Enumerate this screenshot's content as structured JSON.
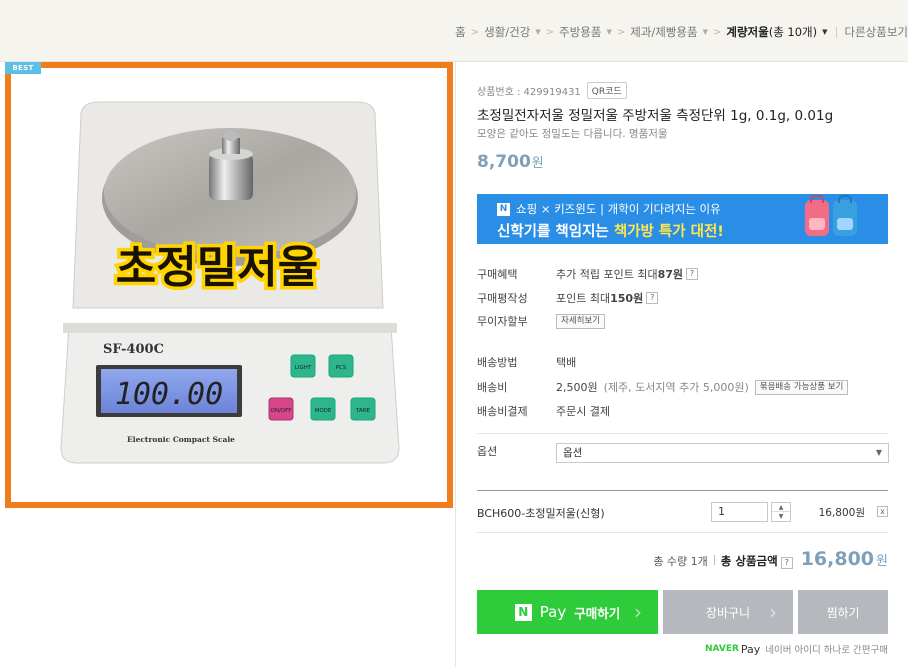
{
  "breadcrumb": {
    "home": "홈",
    "items": [
      "생활/건강",
      "주방용품",
      "제과/제빵용품"
    ],
    "current": "계량저울",
    "count": "(총 10개)",
    "other": "다른상품보기"
  },
  "image": {
    "badge": "BEST",
    "overlay_text": "초정밀저울",
    "device_model": "SF-400C",
    "display_value": "100.00",
    "device_caption": "Electronic Compact Scale",
    "keys": [
      "LIGHT",
      "PCS",
      "ON/OFF",
      "MODE",
      "TARE"
    ]
  },
  "product": {
    "code_label": "상품번호 : 429919431",
    "qr_label": "QR코드",
    "title": "초정밀전자저울 정밀저울 주방저울 측정단위 1g, 0.1g, 0.01g",
    "subtitle": "모양은 같아도 정밀도는 다릅니다. 명품저울",
    "price": "8,700",
    "currency": "원"
  },
  "banner": {
    "badge": "N",
    "line1": "쇼핑 × 키즈윈도 | 개학이 기다려지는 이유",
    "line2_a": "신학기를 책임지는 ",
    "line2_b": "책가방 특가 대전!"
  },
  "info": {
    "benefit_label": "구매혜택",
    "benefit_prefix": "추가 적립 포인트 최대 ",
    "benefit_value": "87원",
    "review_label": "구매평작성",
    "review_prefix": "포인트 최대 ",
    "review_value": "150원",
    "installment_label": "무이자할부",
    "installment_button": "자세히보기",
    "ship_method_label": "배송방법",
    "ship_method_value": "택배",
    "ship_fee_label": "배송비",
    "ship_fee_value": "2,500원",
    "ship_fee_note": "(제주, 도서지역 추가 5,000원)",
    "ship_fee_button": "묶음배송 가능상품 보기",
    "ship_pay_label": "배송비결제",
    "ship_pay_value": "주문시 결제"
  },
  "option": {
    "label": "옵션",
    "placeholder": "옵션"
  },
  "selected": {
    "name": "BCH600-초정밀저울(신형)",
    "qty": "1",
    "price": "16,800원",
    "remove": "x"
  },
  "total": {
    "qty_text": "총 수량 1개",
    "label": "총 상품금액",
    "amount": "16,800",
    "currency": "원"
  },
  "buttons": {
    "npay_logo": "N",
    "pay": "Pay",
    "buy": "구매하기",
    "cart": "장바구니",
    "zzim": "찜하기"
  },
  "footer": {
    "naver": "NAVER",
    "pay": "Pay",
    "text": "네이버 아이디 하나로 간편구매"
  },
  "colors": {
    "accent_price": "#7fa0b8",
    "frame_orange": "#f07d1b",
    "pay_green": "#2ecc3b",
    "banner_blue": "#2a8ee6"
  }
}
